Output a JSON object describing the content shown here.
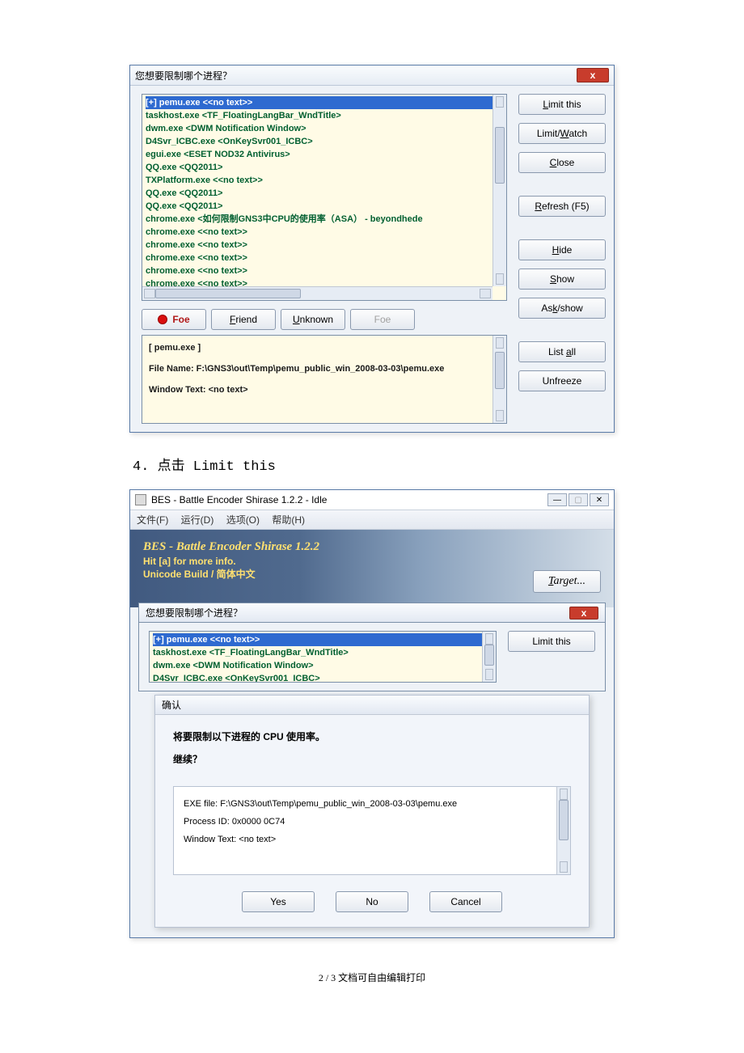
{
  "dialog1": {
    "title": "您想要限制哪个进程？",
    "close": "x",
    "list": [
      "[+] pemu.exe <<no text>>",
      "taskhost.exe <TF_FloatingLangBar_WndTitle>",
      "dwm.exe <DWM Notification Window>",
      "D4Svr_ICBC.exe <OnKeySvr001_ICBC>",
      "egui.exe <ESET NOD32 Antivirus>",
      "QQ.exe <QQ2011>",
      "TXPlatform.exe <<no text>>",
      "QQ.exe <QQ2011>",
      "QQ.exe <QQ2011>",
      "chrome.exe <如何限制GNS3中CPU的使用率（ASA） - beyondhede",
      "chrome.exe <<no text>>",
      "chrome.exe <<no text>>",
      "chrome.exe <<no text>>",
      "chrome.exe <<no text>>",
      "chrome.exe <<no text>>"
    ],
    "btn_foe": "Foe",
    "btn_friend": "Friend",
    "btn_unknown": "Unknown",
    "btn_foe2": "Foe",
    "info_line1": "[ pemu.exe ]",
    "info_line2": "File Name: F:\\GNS3\\out\\Temp\\pemu_public_win_2008-03-03\\pemu.exe",
    "info_line3": "Window Text: <no text>",
    "btn_limit": "Limit this",
    "btn_limitwatch": "Limit/Watch",
    "btn_close": "Close",
    "btn_refresh": "Refresh (F5)",
    "btn_hide": "Hide",
    "btn_show": "Show",
    "btn_askshow": "Ask/show",
    "btn_listall": "List all",
    "btn_unfreeze": "Unfreeze"
  },
  "step4": "4. 点击 Limit this",
  "bes": {
    "title": "BES - Battle Encoder Shirase 1.2.2 - Idle",
    "menu_file": "文件(F)",
    "menu_run": "运行(D)",
    "menu_opt": "选项(O)",
    "menu_help": "帮助(H)",
    "hero1": "BES - Battle Encoder Shirase 1.2.2",
    "hero2": "Hit [a] for more info.",
    "hero3": "Unicode Build / 简体中文",
    "btn_target": "Target...",
    "sub_title": "您想要限制哪个进程？",
    "sub_list": [
      "[+] pemu.exe <<no text>>",
      "taskhost.exe <TF_FloatingLangBar_WndTitle>",
      "dwm.exe <DWM Notification Window>",
      "D4Svr_ICBC.exe <OnKeySvr001_ICBC>"
    ],
    "btn_limit": "Limit this"
  },
  "confirm": {
    "title": "确认",
    "msg1": "将要限制以下进程的 CPU 使用率。",
    "msg2": "继续？",
    "info1": "EXE file: F:\\GNS3\\out\\Temp\\pemu_public_win_2008-03-03\\pemu.exe",
    "info2": "Process ID: 0x0000 0C74",
    "info3": "Window Text: <no text>",
    "yes": "Yes",
    "no": "No",
    "cancel": "Cancel"
  },
  "footer": "2 / 3 文档可自由编辑打印"
}
